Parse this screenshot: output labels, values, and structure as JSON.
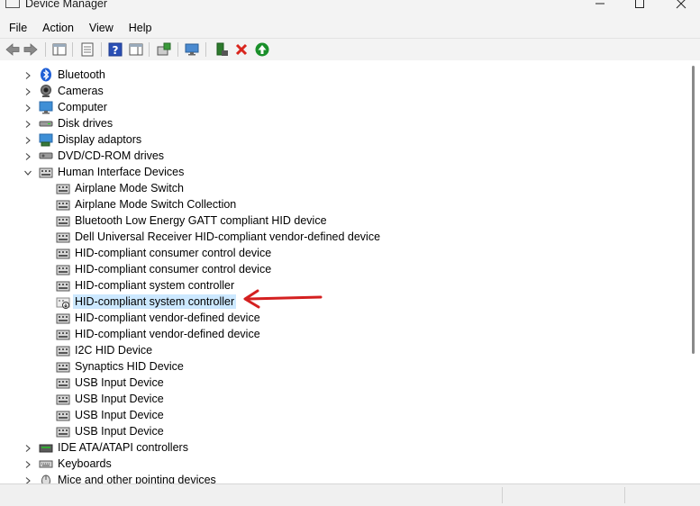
{
  "window": {
    "title": "Device Manager"
  },
  "menu": [
    "File",
    "Action",
    "View",
    "Help"
  ],
  "toolbar": {
    "icons": [
      "back-arrow-icon",
      "forward-arrow-icon",
      "device-tree-icon",
      "properties-icon",
      "help-icon",
      "action-pane-icon",
      "update-driver-icon",
      "monitor-icon",
      "add-device-icon",
      "uninstall-icon",
      "enable-device-icon"
    ],
    "colors": {
      "uninstall": "#d9251d",
      "enable": "#1a8f2a"
    }
  },
  "tree": [
    {
      "label": "Bluetooth",
      "level": 0,
      "expand": "collapsed",
      "icon": "bluetooth-icon"
    },
    {
      "label": "Cameras",
      "level": 0,
      "expand": "collapsed",
      "icon": "camera-icon"
    },
    {
      "label": "Computer",
      "level": 0,
      "expand": "collapsed",
      "icon": "computer-icon"
    },
    {
      "label": "Disk drives",
      "level": 0,
      "expand": "collapsed",
      "icon": "disk-drive-icon"
    },
    {
      "label": "Display adaptors",
      "level": 0,
      "expand": "collapsed",
      "icon": "display-adapter-icon"
    },
    {
      "label": "DVD/CD-ROM drives",
      "level": 0,
      "expand": "collapsed",
      "icon": "dvd-drive-icon"
    },
    {
      "label": "Human Interface Devices",
      "level": 0,
      "expand": "expanded",
      "icon": "hid-icon"
    },
    {
      "label": "Airplane Mode Switch",
      "level": 1,
      "icon": "hid-icon"
    },
    {
      "label": "Airplane Mode Switch Collection",
      "level": 1,
      "icon": "hid-icon"
    },
    {
      "label": "Bluetooth Low Energy GATT compliant HID device",
      "level": 1,
      "icon": "hid-icon"
    },
    {
      "label": "Dell Universal Receiver HID-compliant vendor-defined device",
      "level": 1,
      "icon": "hid-icon"
    },
    {
      "label": "HID-compliant consumer control device",
      "level": 1,
      "icon": "hid-icon"
    },
    {
      "label": "HID-compliant consumer control device",
      "level": 1,
      "icon": "hid-icon"
    },
    {
      "label": "HID-compliant system controller",
      "level": 1,
      "icon": "hid-icon"
    },
    {
      "label": "HID-compliant system controller",
      "level": 1,
      "icon": "hid-disabled-icon",
      "selected": true
    },
    {
      "label": "HID-compliant vendor-defined device",
      "level": 1,
      "icon": "hid-icon"
    },
    {
      "label": "HID-compliant vendor-defined device",
      "level": 1,
      "icon": "hid-icon"
    },
    {
      "label": "I2C HID Device",
      "level": 1,
      "icon": "hid-icon"
    },
    {
      "label": "Synaptics HID Device",
      "level": 1,
      "icon": "hid-icon"
    },
    {
      "label": "USB Input Device",
      "level": 1,
      "icon": "hid-icon"
    },
    {
      "label": "USB Input Device",
      "level": 1,
      "icon": "hid-icon"
    },
    {
      "label": "USB Input Device",
      "level": 1,
      "icon": "hid-icon"
    },
    {
      "label": "USB Input Device",
      "level": 1,
      "icon": "hid-icon"
    },
    {
      "label": "IDE ATA/ATAPI controllers",
      "level": 0,
      "expand": "collapsed",
      "icon": "ide-controller-icon"
    },
    {
      "label": "Keyboards",
      "level": 0,
      "expand": "collapsed",
      "icon": "keyboard-icon"
    },
    {
      "label": "Mice and other pointing devices",
      "level": 0,
      "expand": "collapsed",
      "icon": "mouse-icon"
    }
  ],
  "annotation": {
    "color": "#d42020",
    "icon": "red-arrow-icon"
  }
}
